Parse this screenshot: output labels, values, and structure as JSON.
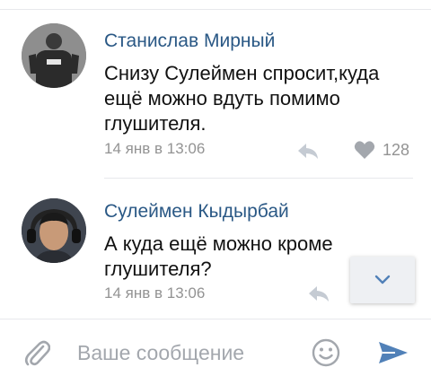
{
  "comments": [
    {
      "author": "Станислав Мирный",
      "text": "Снизу Сулеймен спросит,куда ещё можно вдуть помимо глушителя.",
      "time": "14 янв в 13:06",
      "likes": "128"
    },
    {
      "author": "Сулеймен Кыдырбай",
      "text": "А куда ещё можно кроме глушителя?",
      "time": "14 янв в 13:06"
    }
  ],
  "composer": {
    "placeholder": "Ваше сообщение"
  },
  "icons": {
    "reply": "reply-icon",
    "like": "heart-icon",
    "scroll_down": "chevron-down-icon",
    "attach": "paperclip-icon",
    "emoji": "smiley-icon",
    "send": "send-icon"
  },
  "colors": {
    "author": "#2a5885",
    "meta": "#939393",
    "accent": "#5181b8",
    "icon_gray": "#a3a7ad"
  }
}
